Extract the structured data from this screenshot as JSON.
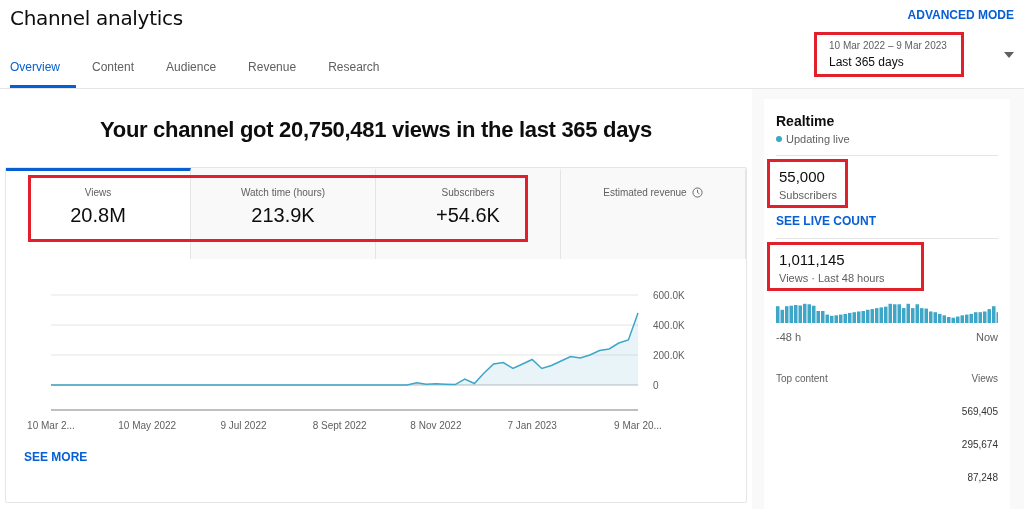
{
  "header": {
    "title": "Channel analytics",
    "advanced_mode": "ADVANCED MODE",
    "tabs": [
      {
        "label": "Overview",
        "selected": true
      },
      {
        "label": "Content",
        "selected": false
      },
      {
        "label": "Audience",
        "selected": false
      },
      {
        "label": "Revenue",
        "selected": false
      },
      {
        "label": "Research",
        "selected": false
      }
    ],
    "date_range": {
      "range": "10 Mar 2022 – 9 Mar 2023",
      "preset": "Last 365 days",
      "highlighted": true
    }
  },
  "headline": "Your channel got 20,750,481 views in the last 365 days",
  "metrics": [
    {
      "label": "Views",
      "value": "20.8M",
      "selected": true,
      "highlighted": true
    },
    {
      "label": "Watch time (hours)",
      "value": "213.9K",
      "selected": false,
      "highlighted": true
    },
    {
      "label": "Subscribers",
      "value": "+54.6K",
      "selected": false,
      "highlighted": true
    },
    {
      "label": "Estimated revenue",
      "selected": false,
      "highlighted": false,
      "kind": "clock"
    }
  ],
  "chart_data": {
    "type": "area",
    "categories": [
      "10 Mar 2...",
      null,
      null,
      null,
      null,
      null,
      null,
      null,
      null,
      null,
      "10 May 2022",
      null,
      null,
      null,
      null,
      null,
      null,
      null,
      null,
      null,
      "9 Jul 2022",
      null,
      null,
      null,
      null,
      null,
      null,
      null,
      null,
      null,
      "8 Sept 2022",
      null,
      null,
      null,
      null,
      null,
      null,
      null,
      null,
      null,
      "8 Nov 2022",
      null,
      null,
      null,
      null,
      null,
      null,
      null,
      null,
      null,
      "7 Jan 2023",
      null,
      null,
      null,
      null,
      null,
      null,
      null,
      null,
      null,
      null,
      "9 Mar 20..."
    ],
    "series": [
      {
        "color": "#3ea6c6",
        "values": [
          0,
          0,
          0,
          0,
          0,
          0,
          0,
          0,
          0,
          0,
          0,
          0,
          0,
          0,
          0,
          0,
          0,
          0,
          0,
          0,
          0,
          0,
          0,
          0,
          0,
          0,
          0,
          0,
          0,
          0,
          0,
          0,
          0,
          0,
          0,
          0,
          0,
          0,
          15000,
          5000,
          8000,
          5000,
          3000,
          40000,
          10000,
          80000,
          140000,
          150000,
          110000,
          140000,
          170000,
          110000,
          130000,
          160000,
          190000,
          180000,
          200000,
          230000,
          240000,
          280000,
          300000,
          480000
        ]
      }
    ],
    "ylim": [
      0,
      600000
    ],
    "yticks": [
      {
        "value": 0,
        "label": "0"
      },
      {
        "value": 200000,
        "label": "200.0K"
      },
      {
        "value": 400000,
        "label": "400.0K"
      },
      {
        "value": 600000,
        "label": "600.0K"
      }
    ]
  },
  "see_more": "SEE MORE",
  "realtime": {
    "title": "Realtime",
    "status": "Updating live",
    "subscribers": {
      "value": "55,000",
      "label": "Subscribers",
      "highlighted": true
    },
    "live_count": "SEE LIVE COUNT",
    "views": {
      "value": "1,011,145",
      "label": "Views · Last 48 hours",
      "highlighted": true
    },
    "axis_start": "-48 h",
    "axis_end": "Now",
    "top_content": {
      "heading": "Top content",
      "views_heading": "Views",
      "rows": [
        {
          "views": "569,405"
        },
        {
          "views": "295,674"
        },
        {
          "views": "87,248"
        }
      ]
    }
  }
}
